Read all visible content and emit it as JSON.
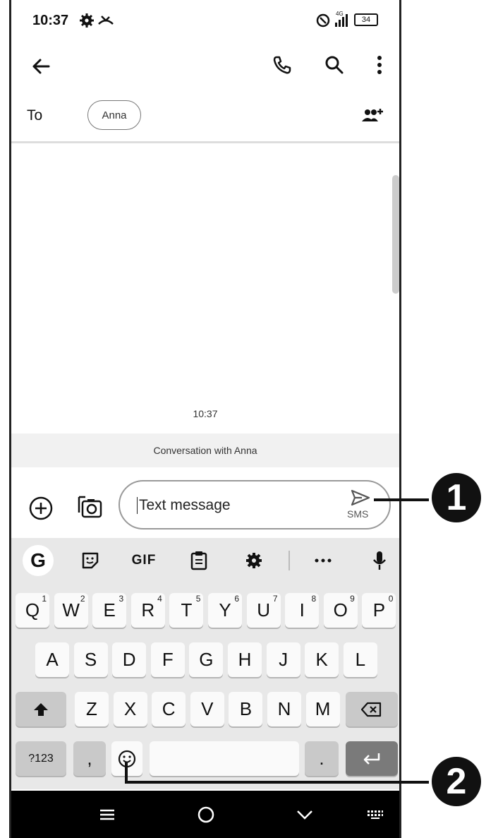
{
  "status_bar": {
    "time": "10:37",
    "battery": "34",
    "network": "4G"
  },
  "top_bar": {
    "back_icon": "arrow-left-icon",
    "call_icon": "phone-icon",
    "search_icon": "search-icon",
    "menu_icon": "more-vert-icon"
  },
  "recipient": {
    "to_label": "To",
    "chip": "Anna",
    "add_icon": "add-people-icon"
  },
  "conversation": {
    "timestamp": "10:37",
    "banner": "Conversation with Anna"
  },
  "compose": {
    "placeholder": "Text message",
    "send_label": "SMS"
  },
  "keyboard": {
    "toolbar": [
      "G",
      "sticker",
      "GIF",
      "clipboard",
      "settings",
      "more",
      "mic"
    ],
    "gif_label": "GIF",
    "row1": [
      {
        "k": "Q",
        "h": "1"
      },
      {
        "k": "W",
        "h": "2"
      },
      {
        "k": "E",
        "h": "3"
      },
      {
        "k": "R",
        "h": "4"
      },
      {
        "k": "T",
        "h": "5"
      },
      {
        "k": "Y",
        "h": "6"
      },
      {
        "k": "U",
        "h": "7"
      },
      {
        "k": "I",
        "h": "8"
      },
      {
        "k": "O",
        "h": "9"
      },
      {
        "k": "P",
        "h": "0"
      }
    ],
    "row2": [
      "A",
      "S",
      "D",
      "F",
      "G",
      "H",
      "J",
      "K",
      "L"
    ],
    "row3": [
      "Z",
      "X",
      "C",
      "V",
      "B",
      "N",
      "M"
    ],
    "symbols_label": "?123",
    "comma": ",",
    "period": "."
  },
  "callouts": [
    "1",
    "2"
  ],
  "colors": {
    "accent": "#111111",
    "keyboard_bg": "#e8e8e8",
    "banner_bg": "#f1f1f1"
  }
}
